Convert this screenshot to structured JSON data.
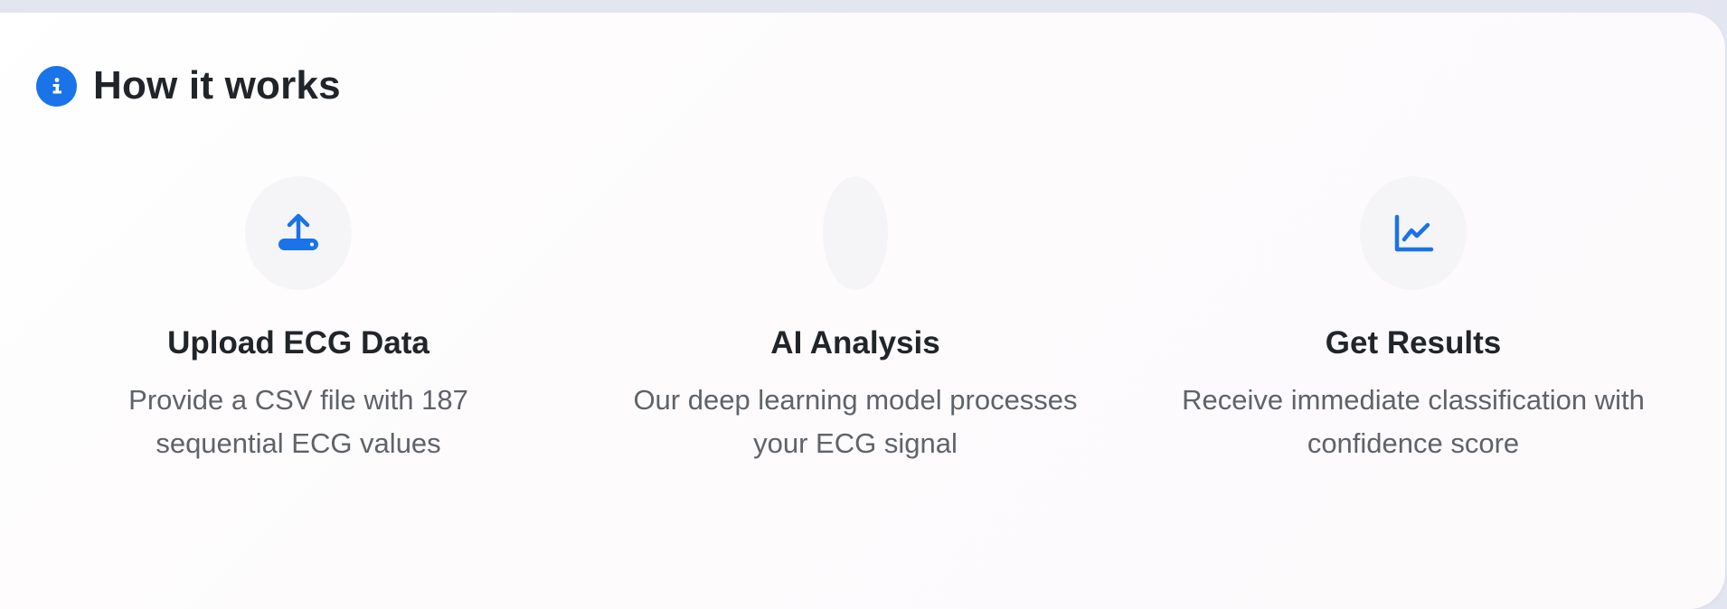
{
  "section": {
    "title": "How it works",
    "icon": "info-icon",
    "accent_color": "#1a73e8"
  },
  "steps": [
    {
      "icon": "upload-icon",
      "title": "Upload ECG Data",
      "description": "Provide a CSV file with 187 sequential ECG values"
    },
    {
      "icon": "",
      "title": "AI Analysis",
      "description": "Our deep learning model processes your ECG signal"
    },
    {
      "icon": "line-chart-icon",
      "title": "Get Results",
      "description": "Receive immediate classification with confidence score"
    }
  ]
}
